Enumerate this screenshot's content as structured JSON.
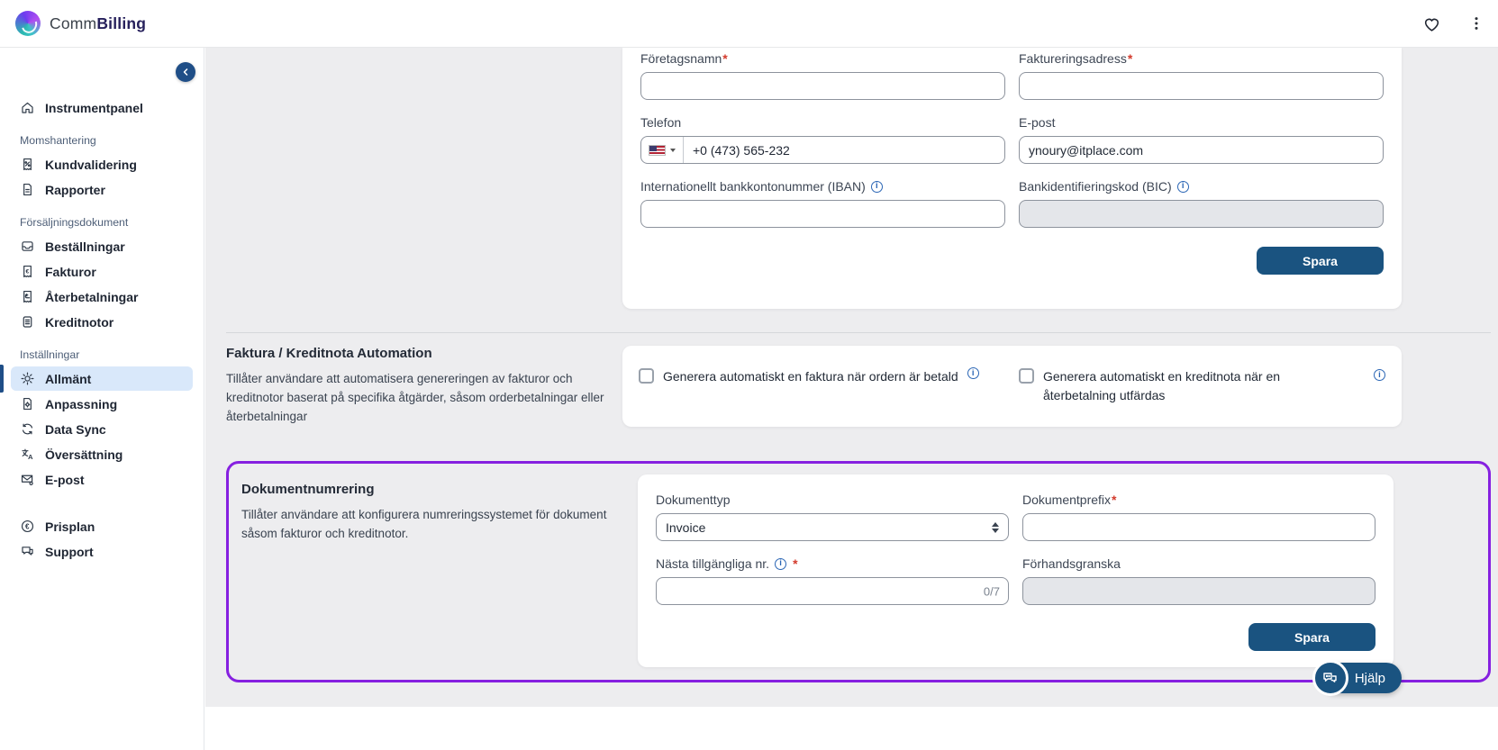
{
  "header": {
    "brand_prefix": "Comm",
    "brand_suffix": "Billing"
  },
  "sidebar": {
    "groups": [
      {
        "label": "",
        "items": [
          {
            "label": "Instrumentpanel",
            "icon": "home-icon",
            "active": false
          }
        ]
      },
      {
        "label": "Momshantering",
        "items": [
          {
            "label": "Kundvalidering",
            "icon": "receipt-percent-icon",
            "active": false
          },
          {
            "label": "Rapporter",
            "icon": "report-icon",
            "active": false
          }
        ]
      },
      {
        "label": "Försäljningsdokument",
        "items": [
          {
            "label": "Beställningar",
            "icon": "inbox-icon",
            "active": false
          },
          {
            "label": "Fakturor",
            "icon": "invoice-icon",
            "active": false
          },
          {
            "label": "Återbetalningar",
            "icon": "refund-icon",
            "active": false
          },
          {
            "label": "Kreditnotor",
            "icon": "credit-note-icon",
            "active": false
          }
        ]
      },
      {
        "label": "Inställningar",
        "items": [
          {
            "label": "Allmänt",
            "icon": "gear-icon",
            "active": true
          },
          {
            "label": "Anpassning",
            "icon": "customize-icon",
            "active": false
          },
          {
            "label": "Data Sync",
            "icon": "sync-icon",
            "active": false
          },
          {
            "label": "Översättning",
            "icon": "translate-icon",
            "active": false
          },
          {
            "label": "E-post",
            "icon": "mail-icon",
            "active": false
          }
        ]
      },
      {
        "label": "",
        "items": [
          {
            "label": "Prisplan",
            "icon": "euro-icon",
            "active": false
          },
          {
            "label": "Support",
            "icon": "support-icon",
            "active": false
          }
        ]
      }
    ]
  },
  "company_form": {
    "company_name": {
      "label": "Företagsnamn",
      "value": ""
    },
    "billing_address": {
      "label": "Faktureringsadress",
      "value": ""
    },
    "phone": {
      "label": "Telefon",
      "value": "+0 (473) 565-232"
    },
    "email": {
      "label": "E-post",
      "value": "ynoury@itplace.com"
    },
    "iban": {
      "label": "Internationellt bankkontonummer (IBAN)",
      "value": ""
    },
    "bic": {
      "label": "Bankidentifieringskod (BIC)",
      "value": ""
    },
    "save_label": "Spara"
  },
  "automation": {
    "title": "Faktura / Kreditnota Automation",
    "description": "Tillåter användare att automatisera genereringen av fakturor och kreditnotor baserat på specifika åtgärder, såsom orderbetalningar eller återbetalningar",
    "invoice_checkbox_label": "Generera automatiskt en faktura när ordern är betald",
    "credit_checkbox_label": "Generera automatiskt en kreditnota när en återbetalning utfärdas"
  },
  "numbering": {
    "title": "Dokumentnumrering",
    "description": "Tillåter användare att konfigurera numreringssystemet för dokument såsom fakturor och kreditnotor.",
    "document_type": {
      "label": "Dokumenttyp",
      "value": "Invoice"
    },
    "document_prefix": {
      "label": "Dokumentprefix",
      "value": ""
    },
    "next_number": {
      "label": "Nästa tillgängliga nr.",
      "value": "",
      "counter": "0/7"
    },
    "preview": {
      "label": "Förhandsgranska",
      "value": ""
    },
    "save_label": "Spara"
  },
  "help": {
    "label": "Hjälp"
  },
  "colors": {
    "accent_blue": "#1a5380",
    "highlight_purple": "#8620e0",
    "active_item_bg": "#d9e8fa",
    "required_red": "#d33a2c",
    "info_blue": "#2b66b5"
  }
}
